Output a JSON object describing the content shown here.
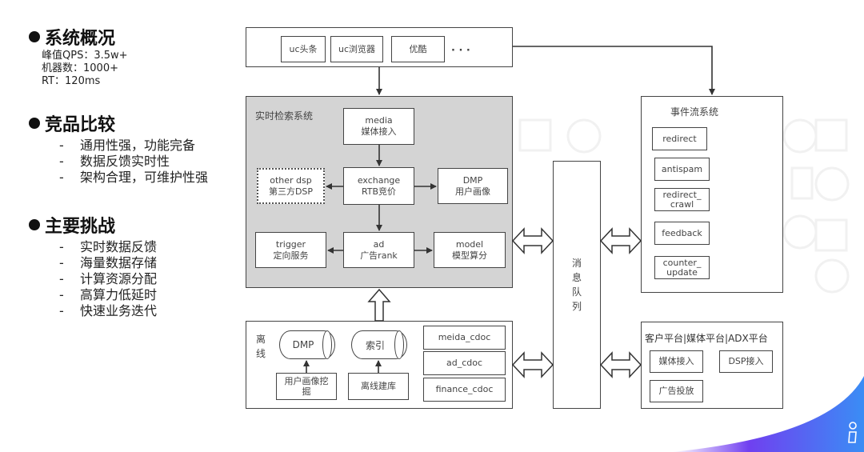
{
  "left": {
    "overview": {
      "title": "系统概况",
      "stats": [
        "峰值QPS：3.5w+",
        "机器数：1000+",
        "RT：120ms"
      ]
    },
    "comparison": {
      "title": "竞品比较",
      "items": [
        "通用性强，功能完备",
        "数据反馈实时性",
        "架构合理，可维护性强"
      ]
    },
    "challenges": {
      "title": "主要挑战",
      "items": [
        "实时数据反馈",
        "海量数据存储",
        "计算资源分配",
        "高算力低延时",
        "快速业务迭代"
      ]
    },
    "dash": "-"
  },
  "diagram": {
    "media_sources": {
      "items": [
        "uc头条",
        "uc浏览器",
        "优酷"
      ],
      "ellipsis": "· · ·"
    },
    "realtime": {
      "title": "实时检索系统",
      "media": [
        "media",
        "媒体接入"
      ],
      "exchange": [
        "exchange",
        "RTB竞价"
      ],
      "other_dsp": [
        "other dsp",
        "第三方DSP"
      ],
      "dmp": [
        "DMP",
        "用户画像"
      ],
      "trigger": [
        "trigger",
        "定向服务"
      ],
      "ad": [
        "ad",
        "广告rank"
      ],
      "model": [
        "model",
        "模型算分"
      ]
    },
    "offline": {
      "title": [
        "离",
        "线"
      ],
      "dmp_store": "DMP",
      "index_store": "索引",
      "user_mining": [
        "用户画像挖",
        "掘"
      ],
      "index_build": "离线建库",
      "docs": [
        "meida_cdoc",
        "ad_cdoc",
        "finance_cdoc"
      ]
    },
    "message_queue": {
      "label": [
        "消",
        "息",
        "队",
        "列"
      ]
    },
    "event_stream": {
      "title": "事件流系统",
      "items": [
        [
          "redirect"
        ],
        [
          "antispam"
        ],
        [
          "redirect_",
          "crawl"
        ],
        [
          "feedback"
        ],
        [
          "counter_",
          "update"
        ]
      ]
    },
    "platforms": {
      "title": "客户平台|媒体平台|ADX平台",
      "items": [
        "媒体接入",
        "DSP接入",
        "广告投放"
      ]
    }
  },
  "colors": {
    "panel_gray": "#d4d4d4",
    "accent_gradient": [
      "#7b3ff2",
      "#3a8df5"
    ]
  }
}
